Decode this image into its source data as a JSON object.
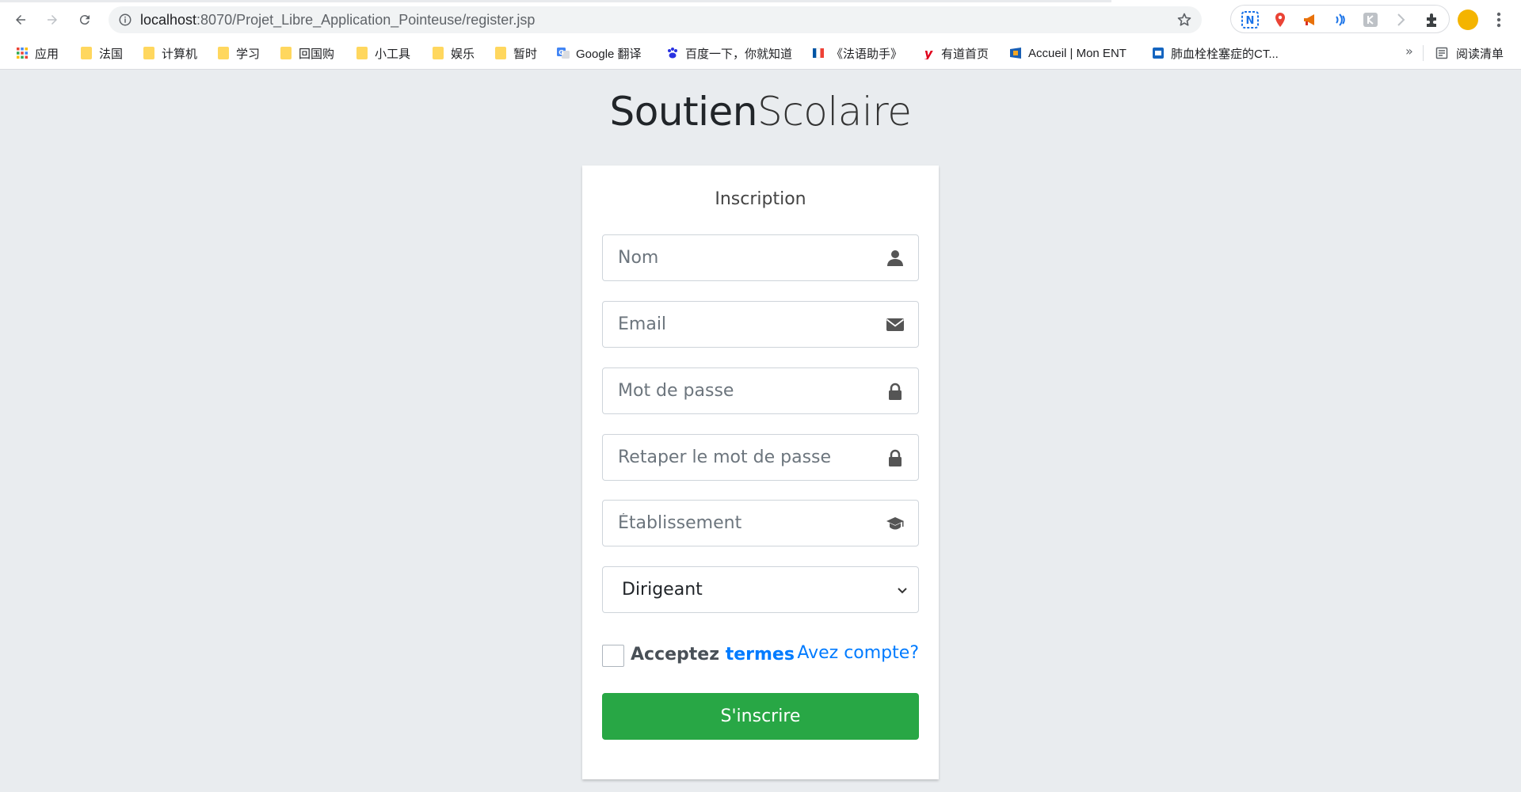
{
  "browser": {
    "url_host": "localhost",
    "url_path": ":8070/Projet_Libre_Application_Pointeuse/register.jsp",
    "bookmarks": [
      {
        "label": "应用",
        "icon": "apps-grid-icon"
      },
      {
        "label": "法国",
        "icon": "folder-icon"
      },
      {
        "label": "计算机",
        "icon": "folder-icon"
      },
      {
        "label": "学习",
        "icon": "folder-icon"
      },
      {
        "label": "回国购",
        "icon": "folder-icon"
      },
      {
        "label": "小工具",
        "icon": "folder-icon"
      },
      {
        "label": "娱乐",
        "icon": "folder-icon"
      },
      {
        "label": "暂时",
        "icon": "folder-icon"
      },
      {
        "label": "Google 翻译",
        "icon": "google-translate-icon"
      },
      {
        "label": "百度一下，你就知道",
        "icon": "baidu-paw-icon"
      },
      {
        "label": "《法语助手》",
        "icon": "frdic-icon"
      },
      {
        "label": "有道首页",
        "icon": "youdao-icon"
      },
      {
        "label": "Accueil | Mon ENT",
        "icon": "ent-icon"
      },
      {
        "label": "肺血栓栓塞症的CT...",
        "icon": "journal-icon"
      }
    ],
    "more_bookmarks": "»",
    "reading_list": "阅读清单"
  },
  "page": {
    "brand_bold": "Soutien",
    "brand_light": "Scolaire",
    "form_title": "Inscription",
    "fields": {
      "nom_placeholder": "Nom",
      "email_placeholder": "Email",
      "password_placeholder": "Mot de passe",
      "password_confirm_placeholder": "Retaper le mot de passe",
      "school_placeholder": "Établissement"
    },
    "role_select": {
      "selected": "Dirigeant"
    },
    "accept_label": "Acceptez",
    "terms_link": "termes",
    "have_account_link": "Avez compte?",
    "submit_label": "S'inscrire"
  },
  "colors": {
    "page_bg": "#e9ecef",
    "card_bg": "#ffffff",
    "primary_link": "#007bff",
    "submit_green": "#28a745"
  }
}
